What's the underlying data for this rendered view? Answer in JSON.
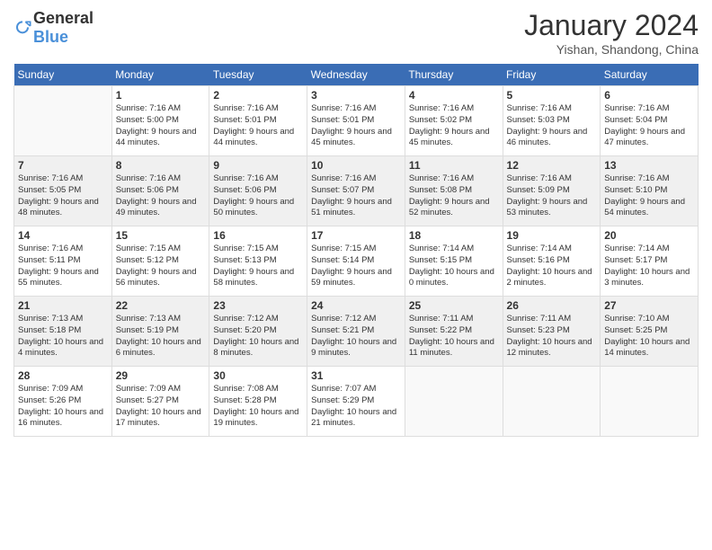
{
  "header": {
    "logo_general": "General",
    "logo_blue": "Blue",
    "title": "January 2024",
    "location": "Yishan, Shandong, China"
  },
  "weekdays": [
    "Sunday",
    "Monday",
    "Tuesday",
    "Wednesday",
    "Thursday",
    "Friday",
    "Saturday"
  ],
  "weeks": [
    [
      {
        "day": "",
        "sunrise": "",
        "sunset": "",
        "daylight": ""
      },
      {
        "day": "1",
        "sunrise": "Sunrise: 7:16 AM",
        "sunset": "Sunset: 5:00 PM",
        "daylight": "Daylight: 9 hours and 44 minutes."
      },
      {
        "day": "2",
        "sunrise": "Sunrise: 7:16 AM",
        "sunset": "Sunset: 5:01 PM",
        "daylight": "Daylight: 9 hours and 44 minutes."
      },
      {
        "day": "3",
        "sunrise": "Sunrise: 7:16 AM",
        "sunset": "Sunset: 5:01 PM",
        "daylight": "Daylight: 9 hours and 45 minutes."
      },
      {
        "day": "4",
        "sunrise": "Sunrise: 7:16 AM",
        "sunset": "Sunset: 5:02 PM",
        "daylight": "Daylight: 9 hours and 45 minutes."
      },
      {
        "day": "5",
        "sunrise": "Sunrise: 7:16 AM",
        "sunset": "Sunset: 5:03 PM",
        "daylight": "Daylight: 9 hours and 46 minutes."
      },
      {
        "day": "6",
        "sunrise": "Sunrise: 7:16 AM",
        "sunset": "Sunset: 5:04 PM",
        "daylight": "Daylight: 9 hours and 47 minutes."
      }
    ],
    [
      {
        "day": "7",
        "sunrise": "Sunrise: 7:16 AM",
        "sunset": "Sunset: 5:05 PM",
        "daylight": "Daylight: 9 hours and 48 minutes."
      },
      {
        "day": "8",
        "sunrise": "Sunrise: 7:16 AM",
        "sunset": "Sunset: 5:06 PM",
        "daylight": "Daylight: 9 hours and 49 minutes."
      },
      {
        "day": "9",
        "sunrise": "Sunrise: 7:16 AM",
        "sunset": "Sunset: 5:06 PM",
        "daylight": "Daylight: 9 hours and 50 minutes."
      },
      {
        "day": "10",
        "sunrise": "Sunrise: 7:16 AM",
        "sunset": "Sunset: 5:07 PM",
        "daylight": "Daylight: 9 hours and 51 minutes."
      },
      {
        "day": "11",
        "sunrise": "Sunrise: 7:16 AM",
        "sunset": "Sunset: 5:08 PM",
        "daylight": "Daylight: 9 hours and 52 minutes."
      },
      {
        "day": "12",
        "sunrise": "Sunrise: 7:16 AM",
        "sunset": "Sunset: 5:09 PM",
        "daylight": "Daylight: 9 hours and 53 minutes."
      },
      {
        "day": "13",
        "sunrise": "Sunrise: 7:16 AM",
        "sunset": "Sunset: 5:10 PM",
        "daylight": "Daylight: 9 hours and 54 minutes."
      }
    ],
    [
      {
        "day": "14",
        "sunrise": "Sunrise: 7:16 AM",
        "sunset": "Sunset: 5:11 PM",
        "daylight": "Daylight: 9 hours and 55 minutes."
      },
      {
        "day": "15",
        "sunrise": "Sunrise: 7:15 AM",
        "sunset": "Sunset: 5:12 PM",
        "daylight": "Daylight: 9 hours and 56 minutes."
      },
      {
        "day": "16",
        "sunrise": "Sunrise: 7:15 AM",
        "sunset": "Sunset: 5:13 PM",
        "daylight": "Daylight: 9 hours and 58 minutes."
      },
      {
        "day": "17",
        "sunrise": "Sunrise: 7:15 AM",
        "sunset": "Sunset: 5:14 PM",
        "daylight": "Daylight: 9 hours and 59 minutes."
      },
      {
        "day": "18",
        "sunrise": "Sunrise: 7:14 AM",
        "sunset": "Sunset: 5:15 PM",
        "daylight": "Daylight: 10 hours and 0 minutes."
      },
      {
        "day": "19",
        "sunrise": "Sunrise: 7:14 AM",
        "sunset": "Sunset: 5:16 PM",
        "daylight": "Daylight: 10 hours and 2 minutes."
      },
      {
        "day": "20",
        "sunrise": "Sunrise: 7:14 AM",
        "sunset": "Sunset: 5:17 PM",
        "daylight": "Daylight: 10 hours and 3 minutes."
      }
    ],
    [
      {
        "day": "21",
        "sunrise": "Sunrise: 7:13 AM",
        "sunset": "Sunset: 5:18 PM",
        "daylight": "Daylight: 10 hours and 4 minutes."
      },
      {
        "day": "22",
        "sunrise": "Sunrise: 7:13 AM",
        "sunset": "Sunset: 5:19 PM",
        "daylight": "Daylight: 10 hours and 6 minutes."
      },
      {
        "day": "23",
        "sunrise": "Sunrise: 7:12 AM",
        "sunset": "Sunset: 5:20 PM",
        "daylight": "Daylight: 10 hours and 8 minutes."
      },
      {
        "day": "24",
        "sunrise": "Sunrise: 7:12 AM",
        "sunset": "Sunset: 5:21 PM",
        "daylight": "Daylight: 10 hours and 9 minutes."
      },
      {
        "day": "25",
        "sunrise": "Sunrise: 7:11 AM",
        "sunset": "Sunset: 5:22 PM",
        "daylight": "Daylight: 10 hours and 11 minutes."
      },
      {
        "day": "26",
        "sunrise": "Sunrise: 7:11 AM",
        "sunset": "Sunset: 5:23 PM",
        "daylight": "Daylight: 10 hours and 12 minutes."
      },
      {
        "day": "27",
        "sunrise": "Sunrise: 7:10 AM",
        "sunset": "Sunset: 5:25 PM",
        "daylight": "Daylight: 10 hours and 14 minutes."
      }
    ],
    [
      {
        "day": "28",
        "sunrise": "Sunrise: 7:09 AM",
        "sunset": "Sunset: 5:26 PM",
        "daylight": "Daylight: 10 hours and 16 minutes."
      },
      {
        "day": "29",
        "sunrise": "Sunrise: 7:09 AM",
        "sunset": "Sunset: 5:27 PM",
        "daylight": "Daylight: 10 hours and 17 minutes."
      },
      {
        "day": "30",
        "sunrise": "Sunrise: 7:08 AM",
        "sunset": "Sunset: 5:28 PM",
        "daylight": "Daylight: 10 hours and 19 minutes."
      },
      {
        "day": "31",
        "sunrise": "Sunrise: 7:07 AM",
        "sunset": "Sunset: 5:29 PM",
        "daylight": "Daylight: 10 hours and 21 minutes."
      },
      {
        "day": "",
        "sunrise": "",
        "sunset": "",
        "daylight": ""
      },
      {
        "day": "",
        "sunrise": "",
        "sunset": "",
        "daylight": ""
      },
      {
        "day": "",
        "sunrise": "",
        "sunset": "",
        "daylight": ""
      }
    ]
  ]
}
